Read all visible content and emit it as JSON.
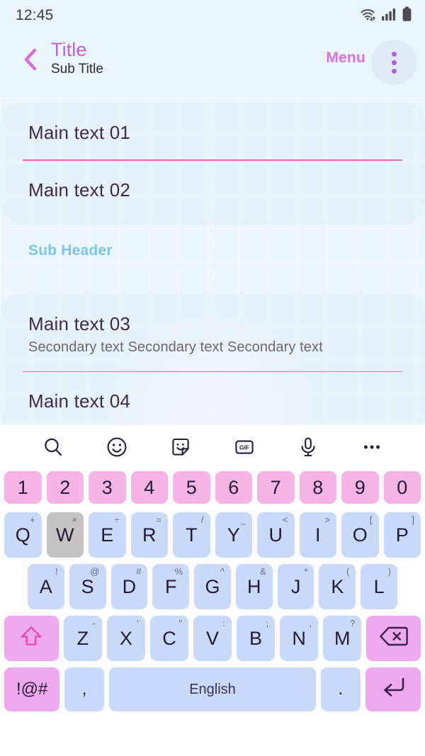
{
  "status_bar": {
    "time": "12:45",
    "icons": [
      "wifi-icon",
      "signal-icon",
      "battery-icon"
    ]
  },
  "app_bar": {
    "back_icon": "chevron-left-icon",
    "title": "Title",
    "subtitle": "Sub Title",
    "menu_label": "Menu",
    "overflow_icon": "overflow-menu-icon"
  },
  "colors": {
    "page_background": "#eaf6fb",
    "title_accent": "#c160e0",
    "menu_accent": "#d96fe0",
    "divider": "#c0419b",
    "sub_header": "#7fc4ec",
    "main_text": "#3d2b4e",
    "secondary_text": "#6b6870",
    "key_letter": "#c8daf8",
    "key_number": "#f6b4e6",
    "key_accent": "#eda8ee",
    "key_pressed": "#c6c4c2",
    "keyboard_background": "#fdfcff"
  },
  "content": {
    "card_one": [
      {
        "main": "Main text 01"
      },
      {
        "main": "Main text 02"
      }
    ],
    "sub_header": "Sub Header",
    "card_two": [
      {
        "main": "Main text 03",
        "secondary": "Secondary text Secondary text Secondary text"
      },
      {
        "main": "Main text 04"
      }
    ]
  },
  "keyboard": {
    "toolbar": [
      {
        "name": "search-icon"
      },
      {
        "name": "emoji-icon"
      },
      {
        "name": "sticker-icon"
      },
      {
        "name": "gif-icon",
        "label": "GIF"
      },
      {
        "name": "microphone-icon"
      },
      {
        "name": "more-options-icon"
      }
    ],
    "row_numbers": [
      {
        "label": "1"
      },
      {
        "label": "2"
      },
      {
        "label": "3"
      },
      {
        "label": "4"
      },
      {
        "label": "5"
      },
      {
        "label": "6"
      },
      {
        "label": "7"
      },
      {
        "label": "8"
      },
      {
        "label": "9"
      },
      {
        "label": "0"
      }
    ],
    "row_top": [
      {
        "label": "Q",
        "alt": "+"
      },
      {
        "label": "W",
        "alt": "×",
        "pressed": true
      },
      {
        "label": "E",
        "alt": "÷"
      },
      {
        "label": "R",
        "alt": "="
      },
      {
        "label": "T",
        "alt": "/"
      },
      {
        "label": "Y",
        "alt": "_"
      },
      {
        "label": "U",
        "alt": "<"
      },
      {
        "label": "I",
        "alt": ">"
      },
      {
        "label": "O",
        "alt": "["
      },
      {
        "label": "P",
        "alt": "]"
      }
    ],
    "row_home": [
      {
        "label": "A",
        "alt": "!"
      },
      {
        "label": "S",
        "alt": "@"
      },
      {
        "label": "D",
        "alt": "#"
      },
      {
        "label": "F",
        "alt": "%"
      },
      {
        "label": "G",
        "alt": "^"
      },
      {
        "label": "H",
        "alt": "&"
      },
      {
        "label": "J",
        "alt": "*"
      },
      {
        "label": "K",
        "alt": "("
      },
      {
        "label": "L",
        "alt": ")"
      }
    ],
    "row_bottom": [
      {
        "label": "Z",
        "alt": "-"
      },
      {
        "label": "X",
        "alt": "'"
      },
      {
        "label": "C",
        "alt": "\""
      },
      {
        "label": "V",
        "alt": ":"
      },
      {
        "label": "B",
        "alt": ";"
      },
      {
        "label": "N",
        "alt": ","
      },
      {
        "label": "M",
        "alt": "?"
      }
    ],
    "shift_key": {
      "name": "shift-key",
      "icon": "shift-arrow-icon"
    },
    "backspace_key": {
      "name": "backspace-key",
      "icon": "backspace-icon"
    },
    "row_space": {
      "symbols_label": "!@#",
      "comma_label": ",",
      "space_label": "English",
      "period_label": ".",
      "enter_icon": "enter-key-icon"
    }
  }
}
